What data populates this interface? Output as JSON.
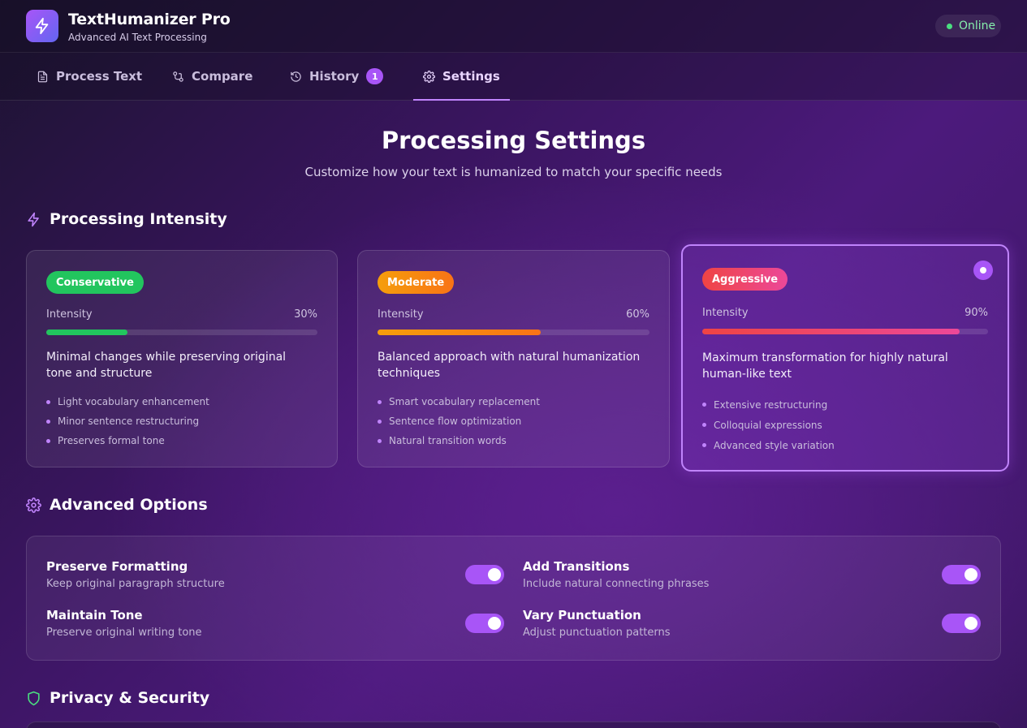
{
  "app": {
    "title": "TextHumanizer Pro",
    "subtitle": "Advanced AI Text Processing",
    "status": "Online",
    "logo_icon": "lightning-icon"
  },
  "tabs": [
    {
      "label": "Process Text",
      "icon": "document-icon"
    },
    {
      "label": "Compare",
      "icon": "compare-icon"
    },
    {
      "label": "History",
      "icon": "history-icon",
      "badge": "1"
    },
    {
      "label": "Settings",
      "icon": "gear-icon",
      "active": true
    }
  ],
  "page": {
    "title": "Processing Settings",
    "subtitle": "Customize how your text is humanized to match your specific needs"
  },
  "intensity_section": {
    "title": "Processing Intensity",
    "icon": "lightning-icon",
    "levels": [
      {
        "name": "Conservative",
        "badge_color": "#22c55e",
        "intensity_label": "Intensity",
        "intensity_value": "30%",
        "intensity_fraction": 0.3,
        "bar_color": "#22c55e",
        "description": "Minimal changes while preserving original tone and structure",
        "features": [
          "Light vocabulary enhancement",
          "Minor sentence restructuring",
          "Preserves formal tone"
        ],
        "selected": false
      },
      {
        "name": "Moderate",
        "badge_color": "#f59e0b",
        "intensity_label": "Intensity",
        "intensity_value": "60%",
        "intensity_fraction": 0.6,
        "bar_color": "#f97316",
        "description": "Balanced approach with natural humanization techniques",
        "features": [
          "Smart vocabulary replacement",
          "Sentence flow optimization",
          "Natural transition words"
        ],
        "selected": false
      },
      {
        "name": "Aggressive",
        "badge_color": "#ef4444",
        "intensity_label": "Intensity",
        "intensity_value": "90%",
        "intensity_fraction": 0.9,
        "bar_color": "#ef4444",
        "description": "Maximum transformation for highly natural human-like text",
        "features": [
          "Extensive restructuring",
          "Colloquial expressions",
          "Advanced style variation"
        ],
        "selected": true
      }
    ]
  },
  "advanced_section": {
    "title": "Advanced Options",
    "icon": "gear-icon",
    "options": [
      {
        "title": "Preserve Formatting",
        "description": "Keep original paragraph structure",
        "enabled": true
      },
      {
        "title": "Add Transitions",
        "description": "Include natural connecting phrases",
        "enabled": true
      },
      {
        "title": "Maintain Tone",
        "description": "Preserve original writing tone",
        "enabled": true
      },
      {
        "title": "Vary Punctuation",
        "description": "Adjust punctuation patterns",
        "enabled": true
      }
    ]
  },
  "privacy_section": {
    "title": "Privacy & Security",
    "icon": "shield-icon"
  },
  "colors": {
    "accent": "#a855f7",
    "accent_light": "#c084fc",
    "online": "#4ade80"
  }
}
